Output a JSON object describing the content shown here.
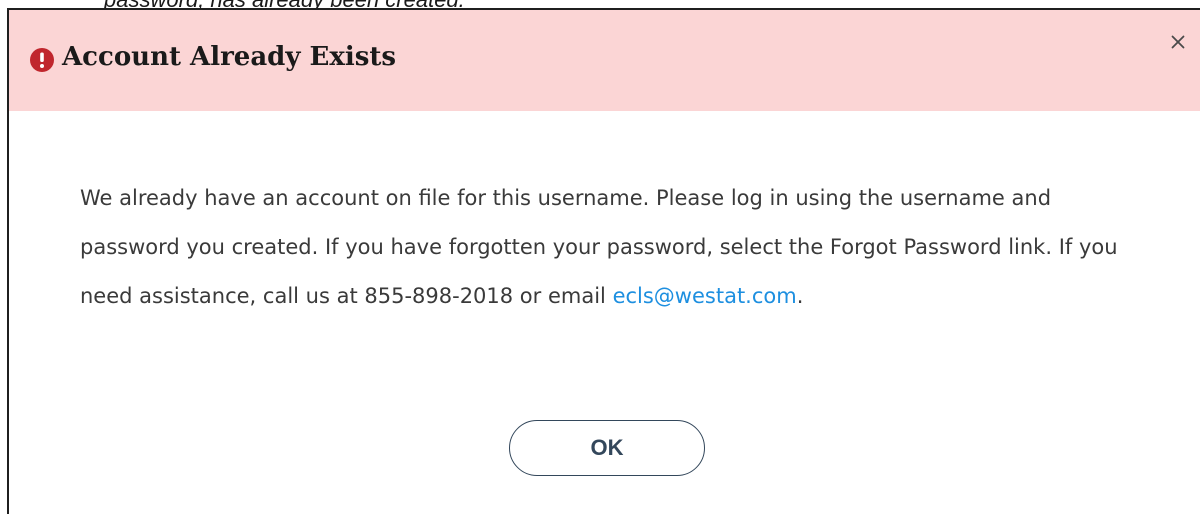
{
  "caption": {
    "text": "password, has already been created."
  },
  "dialog": {
    "title": "Account Already Exists",
    "icon": "alert-circle-icon",
    "close_icon": "close-icon",
    "body": {
      "text_before_link": "We already have an account on file for this username. Please log in using the username and password you created. If you have forgotten your password, select the Forgot Password link. If you need assistance, call us at 855-898-2018 or email ",
      "email_link": "ecls@westat.com",
      "text_after_link": "."
    },
    "ok_label": "OK"
  },
  "colors": {
    "header_bg": "#fbd5d5",
    "alert_icon": "#c0262d",
    "link": "#1d8fe0",
    "button_text": "#33475b",
    "body_text": "#3a3a3a"
  }
}
